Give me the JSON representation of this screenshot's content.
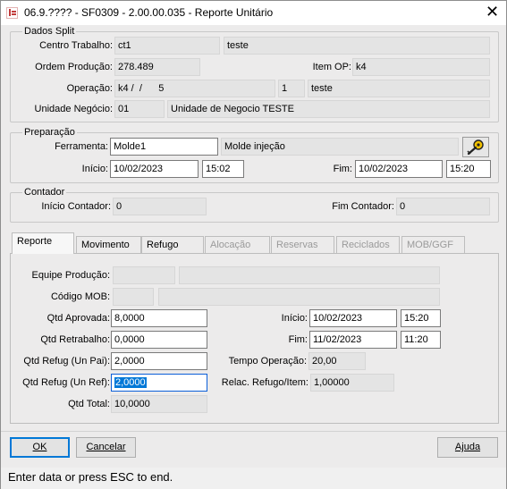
{
  "window": {
    "title": "06.9.???? - SF0309 - 2.00.00.035 - Reporte Unitário",
    "close_glyph": "✕"
  },
  "dados_split": {
    "legend": "Dados Split",
    "centro_trabalho_label": "Centro Trabalho:",
    "centro_trabalho_code": "ct1",
    "centro_trabalho_mid": "",
    "centro_trabalho_desc": "teste",
    "ordem_producao_label": "Ordem Produção:",
    "ordem_producao_value": "278.489",
    "item_op_label": "Item OP:",
    "item_op_value": "k4",
    "operacao_label": "Operação:",
    "operacao_value": "k4 /  /      5",
    "operacao_seq": "1",
    "operacao_desc": "teste",
    "unidade_negocio_label": "Unidade Negócio:",
    "unidade_negocio_code": "01",
    "unidade_negocio_desc": "Unidade de Negocio TESTE"
  },
  "preparacao": {
    "legend": "Preparação",
    "ferramenta_label": "Ferramenta:",
    "ferramenta_value": "Molde1",
    "ferramenta_desc": "Molde injeção",
    "tool_icon": "wrench-key-icon",
    "inicio_label": "Início:",
    "inicio_date": "10/02/2023",
    "inicio_time": "15:02",
    "fim_label": "Fim:",
    "fim_date": "10/02/2023",
    "fim_time": "15:20"
  },
  "contador": {
    "legend": "Contador",
    "inicio_label": "Início Contador:",
    "inicio_value": "0",
    "fim_label": "Fim Contador:",
    "fim_value": "0"
  },
  "tabs": [
    {
      "label": "Reporte",
      "state": "active"
    },
    {
      "label": "Movimento",
      "state": "enabled"
    },
    {
      "label": "Refugo",
      "state": "enabled"
    },
    {
      "label": "Alocação",
      "state": "disabled"
    },
    {
      "label": "Reservas",
      "state": "disabled"
    },
    {
      "label": "Reciclados",
      "state": "disabled"
    },
    {
      "label": "MOB/GGF",
      "state": "disabled"
    }
  ],
  "reporte": {
    "equipe_label": "Equipe Produção:",
    "equipe_code": "",
    "equipe_desc": "",
    "codigo_mob_label": "Código MOB:",
    "codigo_mob_code": "",
    "codigo_mob_desc": "",
    "qtd_aprovada_label": "Qtd Aprovada:",
    "qtd_aprovada_value": "8,0000",
    "qtd_retrabalho_label": "Qtd Retrabalho:",
    "qtd_retrabalho_value": "0,0000",
    "qtd_refug_pai_label": "Qtd Refug (Un Pai):",
    "qtd_refug_pai_value": "2,0000",
    "qtd_refug_ref_label": "Qtd Refug (Un Ref):",
    "qtd_refug_ref_value": "2,0000",
    "qtd_total_label": "Qtd Total:",
    "qtd_total_value": "10,0000",
    "inicio_label": "Início:",
    "inicio_date": "10/02/2023",
    "inicio_time": "15:20",
    "fim_label": "Fim:",
    "fim_date": "11/02/2023",
    "fim_time": "11:20",
    "tempo_operacao_label": "Tempo Operação:",
    "tempo_operacao_value": "20,00",
    "relac_refugo_label": "Relac. Refugo/Item:",
    "relac_refugo_value": "1,00000"
  },
  "buttons": {
    "ok": "OK",
    "cancelar": "Cancelar",
    "ajuda": "Ajuda"
  },
  "status": {
    "message": "Enter data or press ESC to end."
  }
}
